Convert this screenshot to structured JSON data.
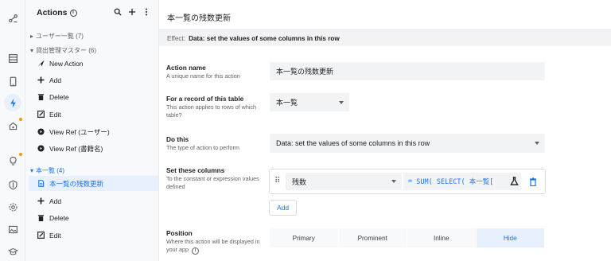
{
  "rail": {
    "icons": [
      "flow-icon",
      "table-icon",
      "phone-icon",
      "bolt-icon",
      "grid-icon",
      "bulb-icon",
      "shield-icon",
      "settings-icon",
      "image-icon",
      "school-icon"
    ]
  },
  "actions_panel": {
    "title": "Actions",
    "info": "i",
    "groups": [
      {
        "label": "ユーザー一覧 (7)"
      },
      {
        "label": "貸出管理マスター (6)"
      },
      {
        "label": "本一覧 (4)"
      }
    ],
    "group2_items": [
      "New Action",
      "Add",
      "Delete",
      "Edit",
      "View Ref (ユーザー)",
      "View Ref (書籍名)"
    ],
    "group3_items": [
      "本一覧の残数更新",
      "Add",
      "Delete",
      "Edit"
    ]
  },
  "editor": {
    "title": "本一覧の残数更新",
    "effect_prefix": "Effect:",
    "effect_value": "Data: set the values of some columns in this row",
    "action_name": {
      "label": "Action name",
      "help": "A unique name for this action",
      "value": "本一覧の残数更新"
    },
    "record_table": {
      "label": "For a record of this table",
      "help": "This action applies to rows of which table?",
      "value": "本一覧"
    },
    "do_this": {
      "label": "Do this",
      "help": "The type of action to perform",
      "value": "Data: set the values of some columns in this row"
    },
    "set_columns": {
      "label": "Set these columns",
      "help": "To the constant or expression values defined",
      "column": "残数",
      "eq": "=",
      "formula": "SUM( SELECT( 本一覧[",
      "add_label": "Add"
    },
    "position": {
      "label": "Position",
      "help": "Where this action will be displayed in your app",
      "options": [
        "Primary",
        "Prominent",
        "Inline",
        "Hide"
      ],
      "selected": "Hide"
    }
  },
  "colors": {
    "accent": "#1a73e8",
    "selected_bg": "#e8f0fe",
    "warning_dot": "#f29900"
  }
}
